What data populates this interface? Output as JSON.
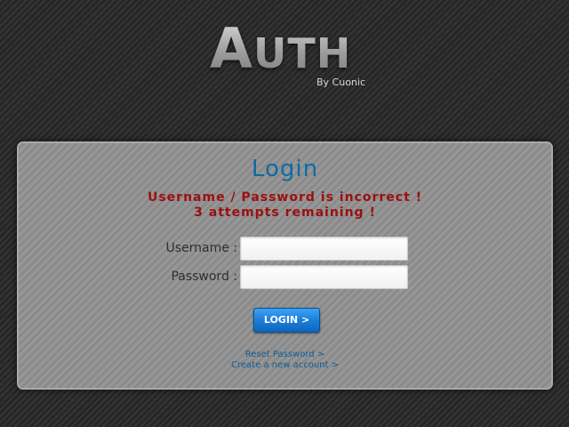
{
  "logo": {
    "title_initial": "A",
    "title_rest": "UTH",
    "subtitle": "By Cuonic"
  },
  "login_panel": {
    "title": "Login",
    "error_line1": "Username / Password is incorrect !",
    "error_line2": "3 attempts remaining !",
    "username_label": "Username :",
    "username_value": "",
    "password_label": "Password :",
    "password_value": "",
    "login_button_label": "LOGIN >",
    "reset_password_link": "Reset Password >",
    "create_account_link": "Create a new account >"
  },
  "colors": {
    "title": "#0f6aa6",
    "error": "#9c0f0f",
    "button": "#1b7fd9",
    "link": "#0f5c96"
  }
}
